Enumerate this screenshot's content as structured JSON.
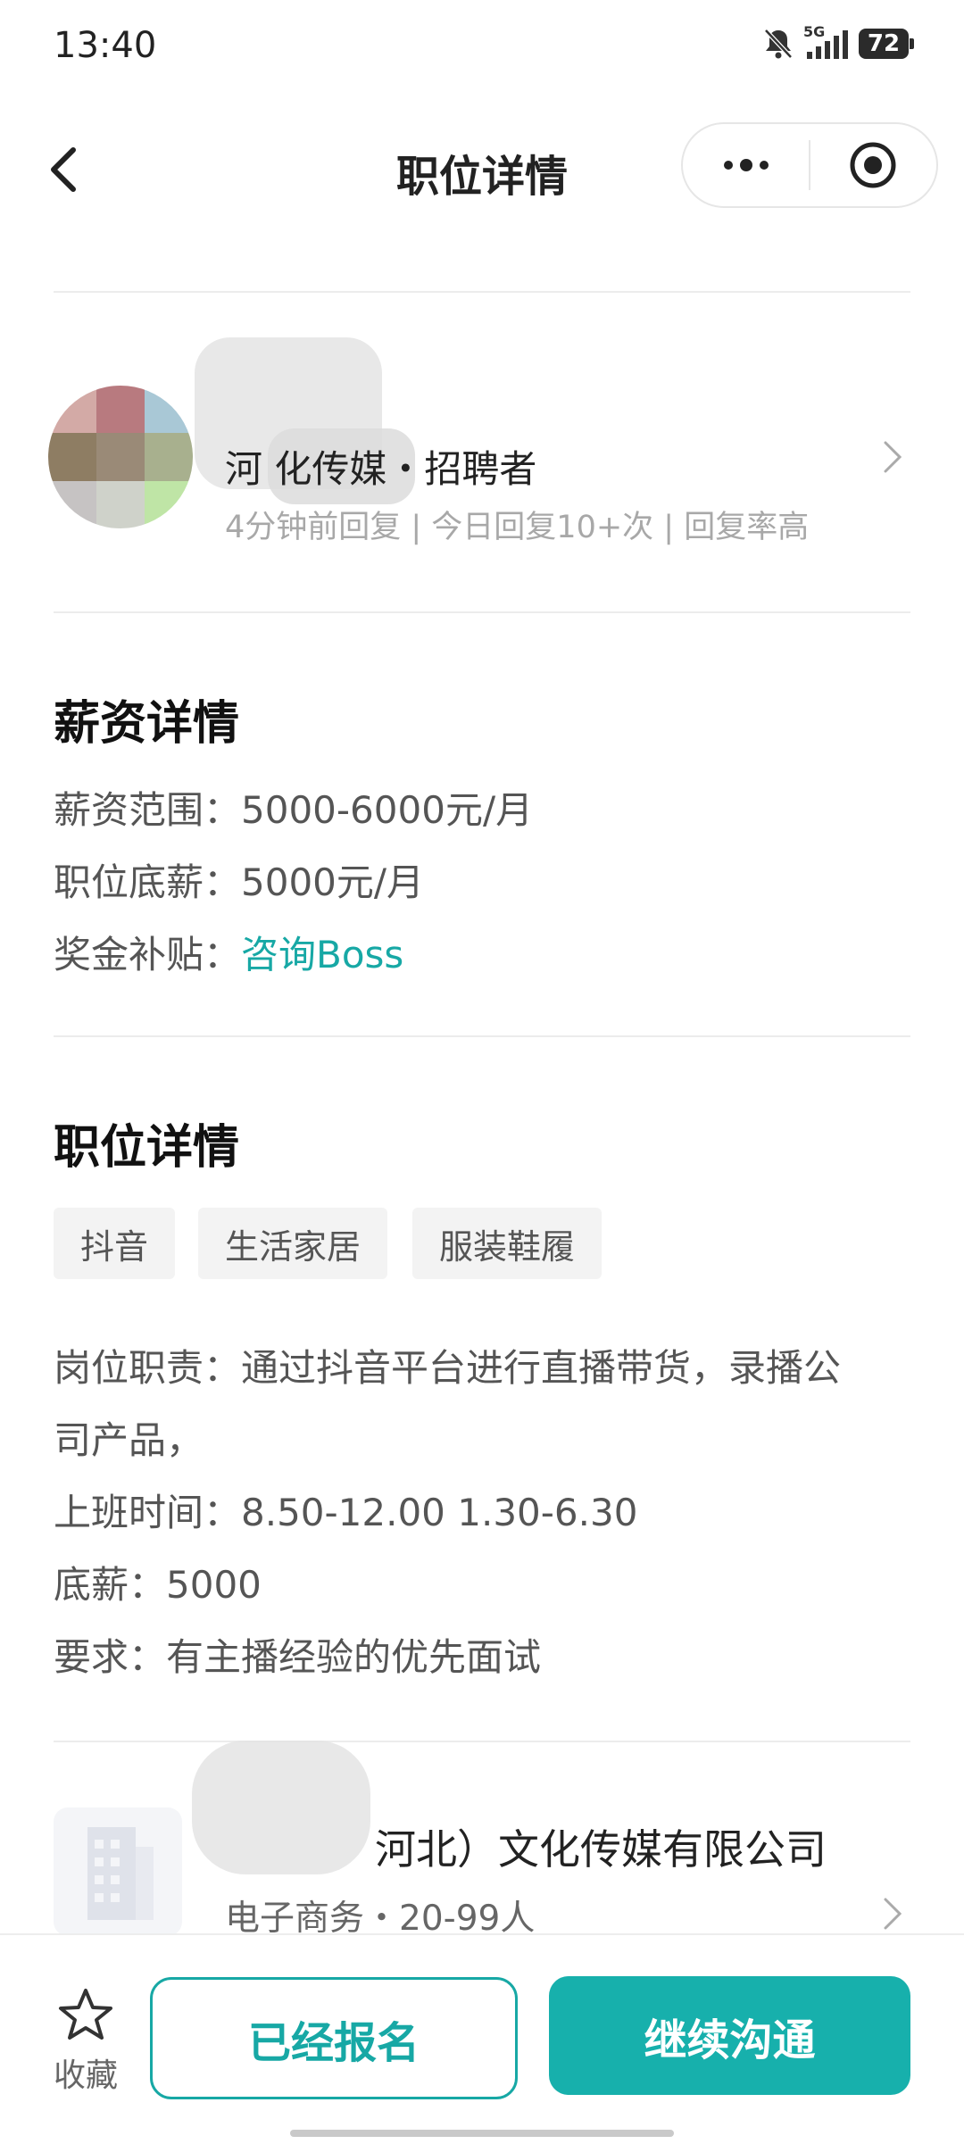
{
  "status_bar": {
    "time": "13:40",
    "network": "5G",
    "battery": "72"
  },
  "header": {
    "title": "职位详情"
  },
  "recruiter": {
    "name": "河                化传媒・招聘者",
    "meta": "4分钟前回复 | 今日回复10+次 | 回复率高"
  },
  "salary": {
    "title": "薪资详情",
    "range_label": "薪资范围：",
    "range_value": "5000-6000元/月",
    "base_label": "职位底薪：",
    "base_value": "5000元/月",
    "bonus_label": "奖金补贴：",
    "bonus_link": "咨询Boss"
  },
  "job": {
    "title": "职位详情",
    "tags": [
      "抖音",
      "生活家居",
      "服装鞋履"
    ],
    "description": [
      "岗位职责：通过抖音平台进行直播带货，录播公",
      "司产品，",
      "上班时间：8.50-12.00 1.30-6.30",
      "底薪：5000",
      "要求：有主播经验的优先面试"
    ]
  },
  "company": {
    "name": "河北）文化传媒有限公司",
    "meta": "电子商务・20-99人"
  },
  "bottom": {
    "favorite_label": "收藏",
    "applied_label": "已经报名",
    "continue_label": "继续沟通"
  },
  "colors": {
    "accent": "#17a8a5",
    "button_fill": "#17b0ac"
  }
}
